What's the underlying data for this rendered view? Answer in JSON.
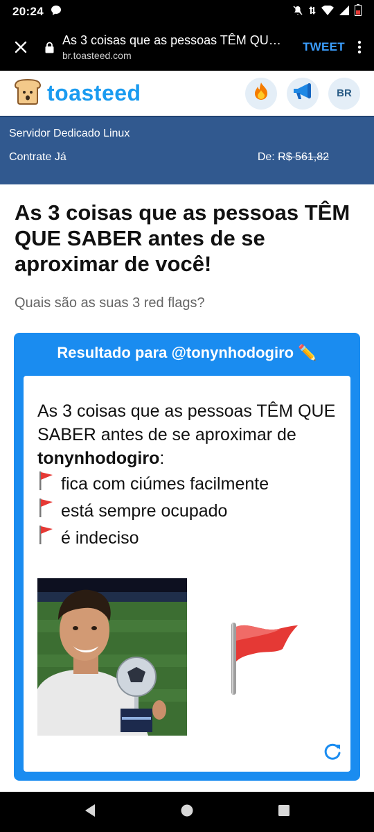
{
  "status": {
    "time": "20:24"
  },
  "browser": {
    "tab_title": "As 3 coisas que as pessoas TÊM QUE SABER antes de se aproximar de você!",
    "domain": "br.toasteed.com",
    "tweet_label": "TWEET"
  },
  "site": {
    "logo_text": "toasteed",
    "region_label": "BR",
    "brand_color": "#1a9bf0"
  },
  "ad": {
    "line1": "Servidor Dedicado Linux",
    "line2": "Contrate Já",
    "price_prefix": "De: ",
    "price_old": "R$ 561,82"
  },
  "main": {
    "title": "As 3 coisas que as pessoas TÊM QUE SABER antes de se aproximar de você!",
    "subtitle": "Quais são as suas 3 red flags?"
  },
  "result": {
    "header": "Resultado para @tonynhodogiro ✏️",
    "intro": "As 3 coisas que as pessoas TÊM QUE SABER antes de se aproximar de ",
    "username": "tonynhodogiro",
    "colon": ":",
    "items": [
      "fica com ciúmes facilmente",
      "está sempre ocupado",
      "é indeciso"
    ]
  },
  "icons": {
    "close": "close-icon",
    "lock": "lock-icon",
    "menu": "more-vert-icon",
    "fire": "fire-icon",
    "megaphone": "megaphone-icon",
    "flag": "red-flag-icon",
    "refresh": "refresh-icon"
  }
}
